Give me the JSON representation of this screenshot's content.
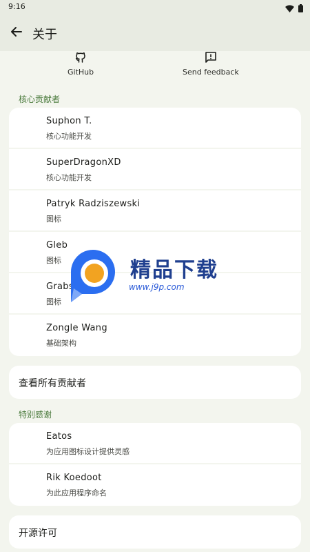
{
  "status_bar": {
    "time": "9:16"
  },
  "app_bar": {
    "title": "关于"
  },
  "links": [
    {
      "label": "GitHub",
      "icon": "github-icon"
    },
    {
      "label": "Send feedback",
      "icon": "feedback-icon"
    }
  ],
  "core_contributors": {
    "title": "核心贡献者",
    "people": [
      {
        "name": "Suphon T.",
        "role": "核心功能开发"
      },
      {
        "name": "SuperDragonXD",
        "role": "核心功能开发"
      },
      {
        "name": "Patryk Radziszewski",
        "role": "图标"
      },
      {
        "name": "Gleb",
        "role": "图标"
      },
      {
        "name": "Grabster",
        "role": "图标"
      },
      {
        "name": "Zongle Wang",
        "role": "基础架构"
      }
    ]
  },
  "view_all_contributors": "查看所有贡献者",
  "special_thanks": {
    "title": "特别感谢",
    "people": [
      {
        "name": "Eatos",
        "role": "为应用图标设计提供灵感"
      },
      {
        "name": "Rik Koedoot",
        "role": "为此应用程序命名"
      }
    ]
  },
  "open_source_licenses": "开源许可",
  "watermark": {
    "text": "精品下载",
    "url": "www.j9p.com"
  },
  "colors": {
    "accent": "#4a7a3c",
    "background": "#f3f5ee",
    "card": "#ffffff",
    "app_bar": "#e8ebe2"
  }
}
